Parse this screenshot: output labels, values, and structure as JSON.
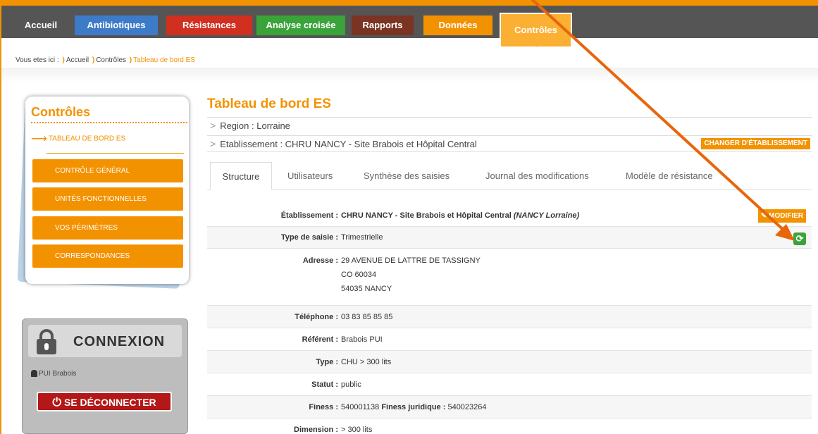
{
  "nav": {
    "tabs": [
      {
        "label": "Accueil"
      },
      {
        "label": "Antibiotiques"
      },
      {
        "label": "Résistances"
      },
      {
        "label": "Analyse croisée"
      },
      {
        "label": "Rapports"
      },
      {
        "label": "Données"
      },
      {
        "label": "Contrôles"
      }
    ]
  },
  "breadcrumb": {
    "prefix": "Vous etes ici :",
    "items": [
      "Accueil",
      "Contrôles",
      "Tableau de bord ES"
    ]
  },
  "sidebar": {
    "title": "Contrôles",
    "active_item": "TABLEAU DE BORD ES",
    "items": [
      {
        "label": "CONTRÔLE GÉNÉRAL"
      },
      {
        "label": "UNITÉS FONCTIONNELLES"
      },
      {
        "label": "VOS PÉRIMÈTRES"
      },
      {
        "label": "CORRESPONDANCES"
      }
    ]
  },
  "login": {
    "title": "CONNEXION",
    "user": "PUI Brabois",
    "logout_label": "SE DÉCONNECTER"
  },
  "main": {
    "title": "Tableau de bord ES",
    "region": "Region : Lorraine",
    "etablissement": "Etablissement : CHRU NANCY - Site Brabois et Hôpital Central",
    "change_button": "CHANGER D'ÉTABLISSEMENT",
    "tabs": [
      {
        "label": "Structure"
      },
      {
        "label": "Utilisateurs"
      },
      {
        "label": "Synthèse des saisies"
      },
      {
        "label": "Journal des modifications"
      },
      {
        "label": "Modèle de résistance"
      }
    ],
    "modify_button": "MODIFIER",
    "fields": {
      "etab_label": "Établissement :",
      "etab_value": "CHRU NANCY - Site Brabois et Hôpital Central",
      "etab_location": "(NANCY Lorraine)",
      "saisie_label": "Type de saisie :",
      "saisie_value": "Trimestrielle",
      "adresse_label": "Adresse :",
      "adresse_lines": [
        "29 AVENUE DE LATTRE DE TASSIGNY",
        "CO 60034",
        "54035 NANCY"
      ],
      "tel_label": "Téléphone :",
      "tel_value": "03 83 85 85 85",
      "referent_label": "Référent :",
      "referent_value": "Brabois PUI",
      "type_label": "Type :",
      "type_value": "CHU > 300 lits",
      "statut_label": "Statut :",
      "statut_value": "public",
      "finess_label": "Finess :",
      "finess_value": "540001138",
      "finess_jur_label": "Finess juridique :",
      "finess_jur_value": "540023264",
      "dimension_label": "Dimension :",
      "dimension_value": "> 300 lits"
    }
  },
  "colors": {
    "accent": "#f39200",
    "annotation_arrow": "#e8650a",
    "refresh_green": "#3aa33a",
    "logout_red": "#b31717"
  }
}
